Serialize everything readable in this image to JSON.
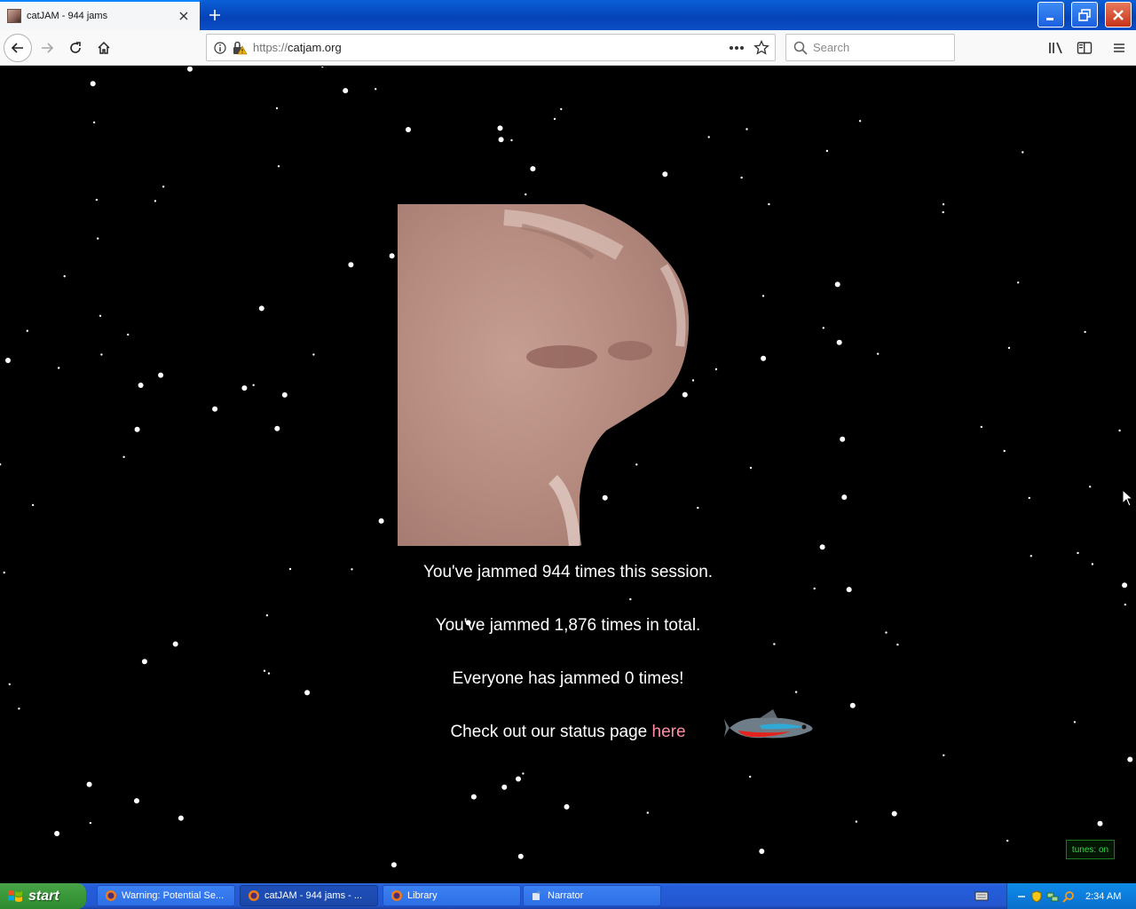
{
  "browser": {
    "tab": {
      "title": "catJAM - 944 jams",
      "icon": "cat-favicon"
    },
    "url": {
      "scheme": "https://",
      "host": "catjam.org"
    },
    "search": {
      "placeholder": "Search"
    }
  },
  "page": {
    "session_text": "You've jammed 944 times this session.",
    "total_text": "You've jammed 1,876 times in total.",
    "everyone_text": "Everyone has jammed 0 times!",
    "status_prefix": "Check out our status page ",
    "status_link": "here",
    "link_color": "#ff8fa0",
    "tunes_toggle": "tunes: on"
  },
  "taskbar": {
    "start_label": "start",
    "tasks": [
      {
        "label": "Warning: Potential Se...",
        "icon": "firefox-icon",
        "active": false
      },
      {
        "label": "catJAM - 944 jams - ...",
        "icon": "firefox-icon",
        "active": true
      },
      {
        "label": "Library",
        "icon": "firefox-icon",
        "active": false
      },
      {
        "label": "Narrator",
        "icon": "narrator-icon",
        "active": false
      }
    ],
    "clock": "2:34 AM"
  }
}
